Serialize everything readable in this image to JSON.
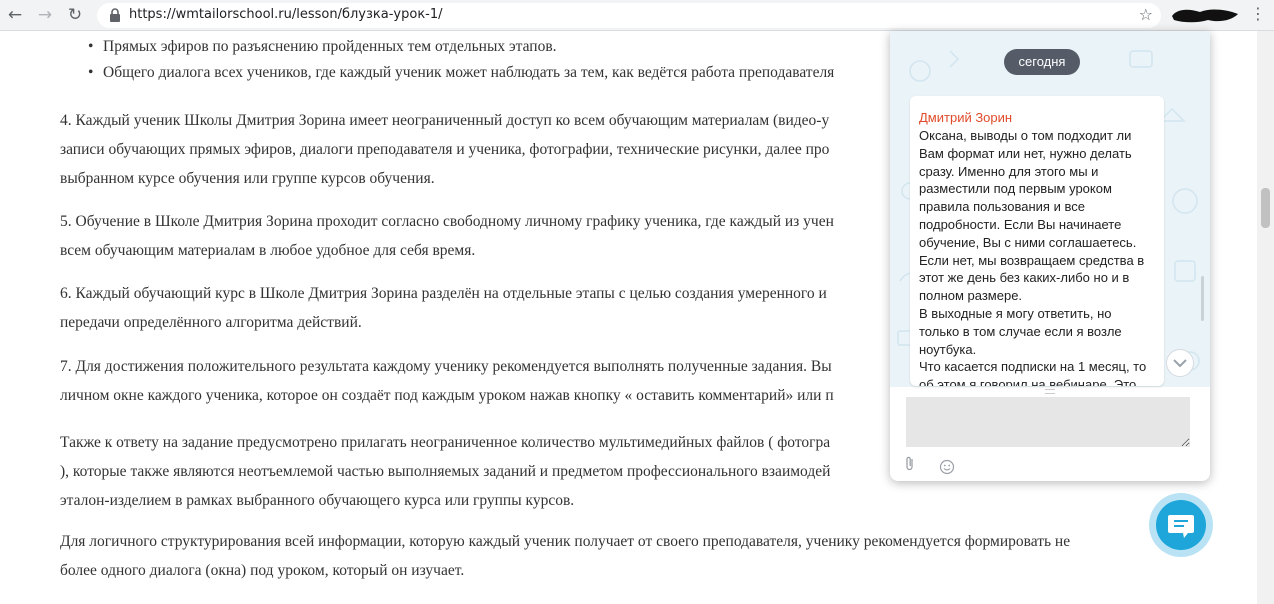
{
  "browser": {
    "url": "https://wmtailorschool.ru/lesson/блузка-урок-1/",
    "back_icon": "arrow-left-icon",
    "forward_icon": "arrow-right-icon",
    "reload_icon": "reload-icon",
    "back_glyph": "←",
    "forward_glyph": "→",
    "reload_glyph": "↻",
    "star_glyph": "☆",
    "menu_glyph": "⋮"
  },
  "content": {
    "bullets": [
      "Прямых эфиров по разъяснению пройденных тем отдельных этапов.",
      "Общего диалога всех учеников, где каждый ученик может наблюдать за тем, как ведётся работа преподавателя"
    ],
    "paragraphs": [
      {
        "lines": [
          "4. Каждый ученик Школы Дмитрия Зорина имеет неограниченный доступ ко всем обучающим материалам (видео-у",
          "записи обучающих прямых эфиров, диалоги преподавателя и ученика, фотографии, технические рисунки, далее про",
          "выбранном курсе обучения или группе курсов обучения."
        ]
      },
      {
        "lines": [
          "5. Обучение в Школе Дмитрия Зорина проходит согласно свободному личному графику ученика, где каждый из учен",
          "всем обучающим материалам в любое удобное для себя время."
        ]
      },
      {
        "lines": [
          "6. Каждый обучающий курс в Школе Дмитрия Зорина разделён на отдельные этапы с целью создания умеренного и",
          "передачи определённого алгоритма действий."
        ]
      },
      {
        "lines": [
          "7. Для достижения положительного результата каждому ученику рекомендуется выполнять полученные задания. Вы",
          "личном окне каждого ученика, которое он создаёт под каждым уроком нажав кнопку « оставить комментарий» или п"
        ]
      },
      {
        "lines": [
          " Также к ответу на задание предусмотрено прилагать неограниченное количество мультимедийных файлов ( фотогра",
          "), которые также являются неотъемлемой частью выполняемых заданий и предметом профессионального взаимодей",
          "эталон-изделием в рамках выбранного обучающего курса  или группы курсов."
        ]
      },
      {
        "lines": [
          " Для логичного структурирования всей информации, которую каждый ученик получает от своего преподавателя, ученику рекомендуется формировать не",
          "более одного диалога (окна) под уроком, который он изучает."
        ]
      }
    ]
  },
  "chat": {
    "date_label": "сегодня",
    "sender": "Дмитрий Зорин",
    "message_lines": [
      "Оксана, выводы о том подходит ли",
      "Вам формат или нет, нужно делать",
      "сразу. Именно для этого мы и",
      "разместили под первым уроком",
      "правила пользования и все",
      "подробности. Если Вы начинаете",
      "обучение, Вы с ними соглашаетесь.",
      "Если нет, мы возвращаем средства в",
      "этот же день без каких-либо но и в",
      "полном размере.",
      "В выходные я могу ответить, но",
      "только в том случае если я возле",
      "ноутбука.",
      "Что касается подписки на 1 месяц, то",
      "об этом я говорил на вебинаре. Это"
    ],
    "input_value": "",
    "colors": {
      "accent": "#1ea5d9",
      "sender": "#e04b2a",
      "pill": "#555c68"
    }
  }
}
